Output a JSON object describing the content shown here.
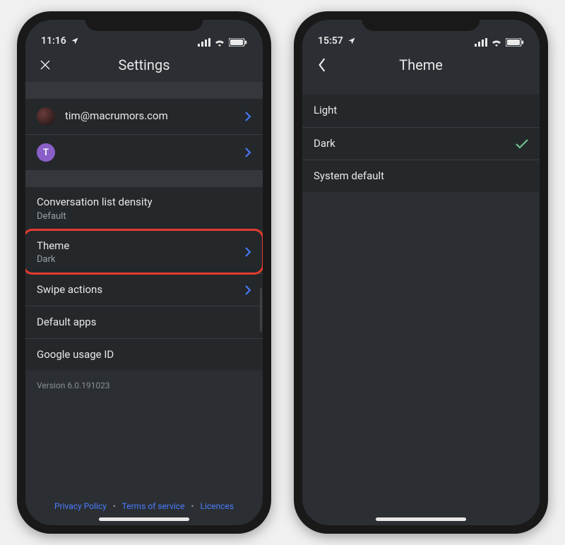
{
  "left": {
    "status_time": "11:16",
    "header_title": "Settings",
    "accounts": [
      {
        "label": "tim@macrumors.com",
        "avatar_kind": "pic",
        "initial": ""
      },
      {
        "label": "",
        "avatar_kind": "letter",
        "initial": "T"
      }
    ],
    "rows": {
      "density_title": "Conversation list density",
      "density_value": "Default",
      "theme_title": "Theme",
      "theme_value": "Dark",
      "swipe_title": "Swipe actions",
      "default_apps_title": "Default apps",
      "usage_id_title": "Google usage ID"
    },
    "version": "Version 6.0.191023",
    "footer": {
      "privacy": "Privacy Policy",
      "terms": "Terms of service",
      "licences": "Licences"
    }
  },
  "right": {
    "status_time": "15:57",
    "header_title": "Theme",
    "options": {
      "light": "Light",
      "dark": "Dark",
      "system_default": "System default"
    },
    "selected": "dark"
  }
}
